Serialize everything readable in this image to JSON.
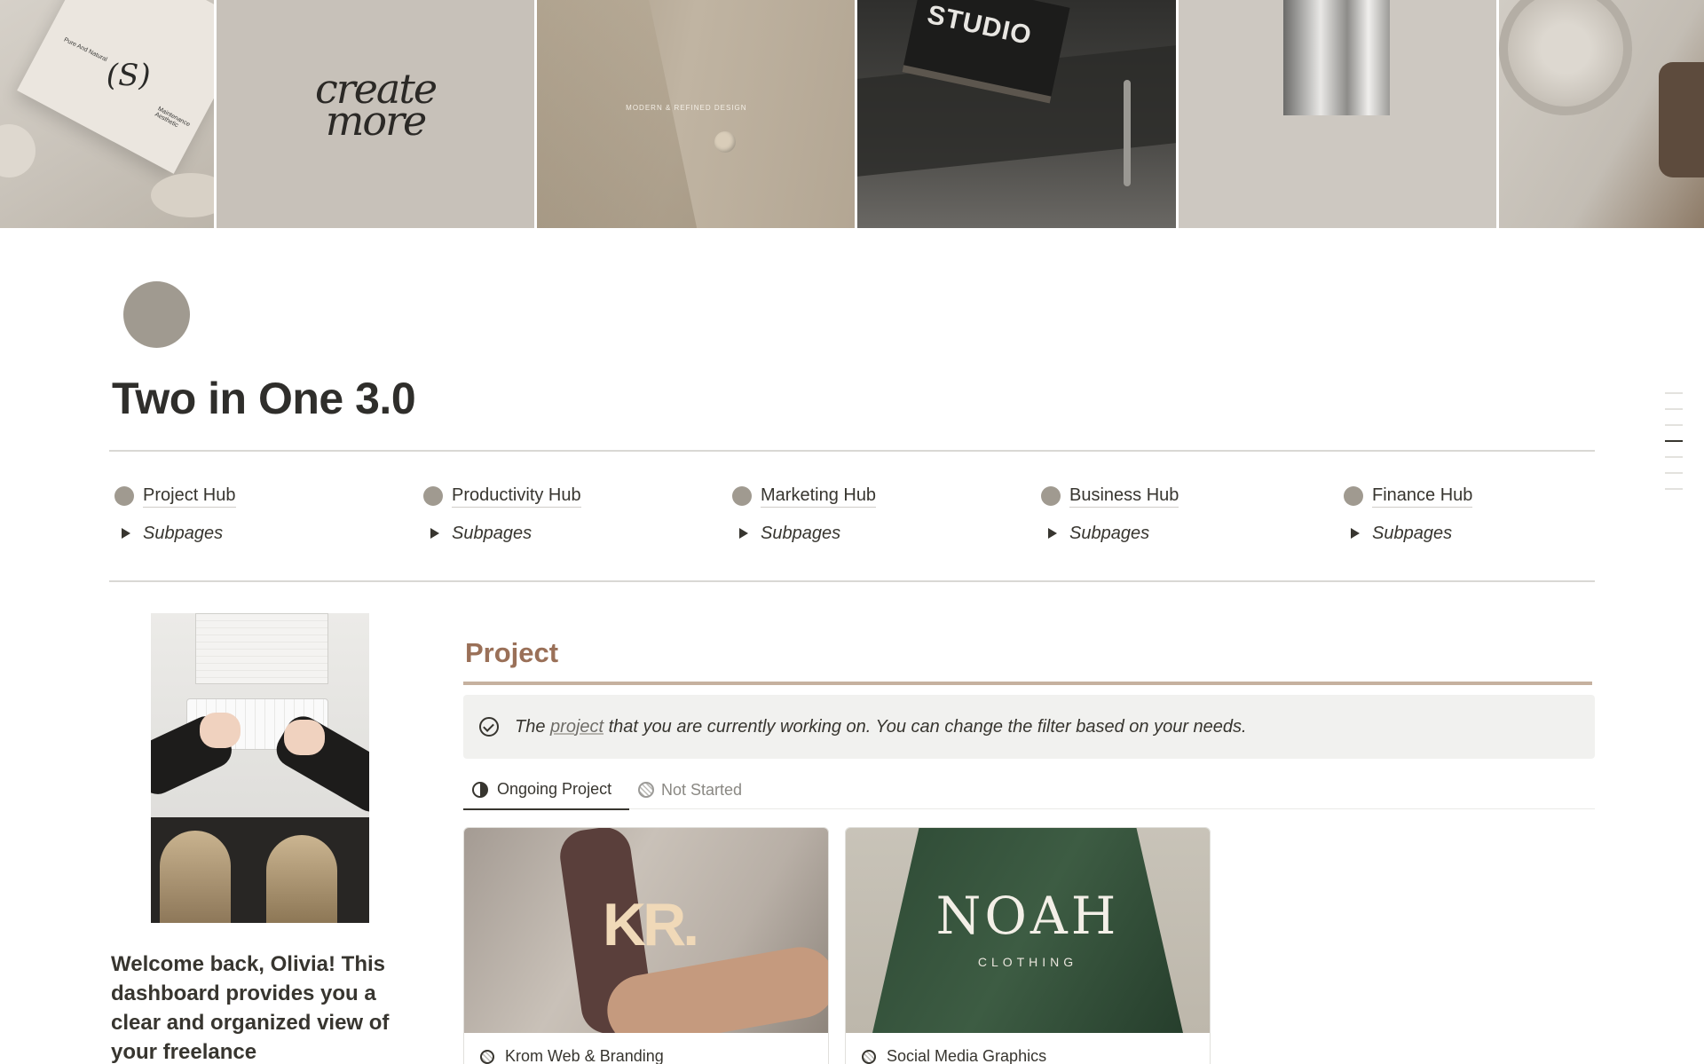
{
  "cover": {
    "tile1": {
      "tiny_left": "Pure And Natural",
      "tiny_right": "Maintenance Aesthetic",
      "monogram": "(S)"
    },
    "tile2": {
      "text_line1": "create",
      "text_line2": "more"
    },
    "tile3": {
      "text": "MODERN   &   REFINED   DESIGN"
    },
    "tile4": {
      "book_text": "STUDIO"
    }
  },
  "page": {
    "title": "Two in One 3.0"
  },
  "hubs": [
    {
      "label": "Project Hub",
      "sub": "Subpages"
    },
    {
      "label": "Productivity Hub",
      "sub": "Subpages"
    },
    {
      "label": "Marketing Hub",
      "sub": "Subpages"
    },
    {
      "label": "Business Hub",
      "sub": "Subpages"
    },
    {
      "label": "Finance Hub",
      "sub": "Subpages"
    }
  ],
  "welcome": {
    "text": "Welcome back, Olivia! This dashboard provides you a clear and organized view of your freelance"
  },
  "project": {
    "heading": "Project",
    "callout_before": "The ",
    "callout_link": "project",
    "callout_after": " that you are currently working on. You can change the filter based on your needs.",
    "tabs": [
      {
        "label": "Ongoing Project",
        "icon": "half-circle-icon",
        "active": true
      },
      {
        "label": "Not Started",
        "icon": "hatched-circle-icon",
        "active": false
      }
    ],
    "cards": [
      {
        "title": "Krom Web & Branding",
        "logo": "KR."
      },
      {
        "title": "Social Media Graphics",
        "logo": "NOAH",
        "logo_sub": "CLOTHING"
      }
    ]
  },
  "colors": {
    "accent_heading": "#9a7058",
    "accent_rule": "#c6b19f",
    "hub_dot": "#a09a90",
    "callout_bg": "#f1f1ef"
  }
}
